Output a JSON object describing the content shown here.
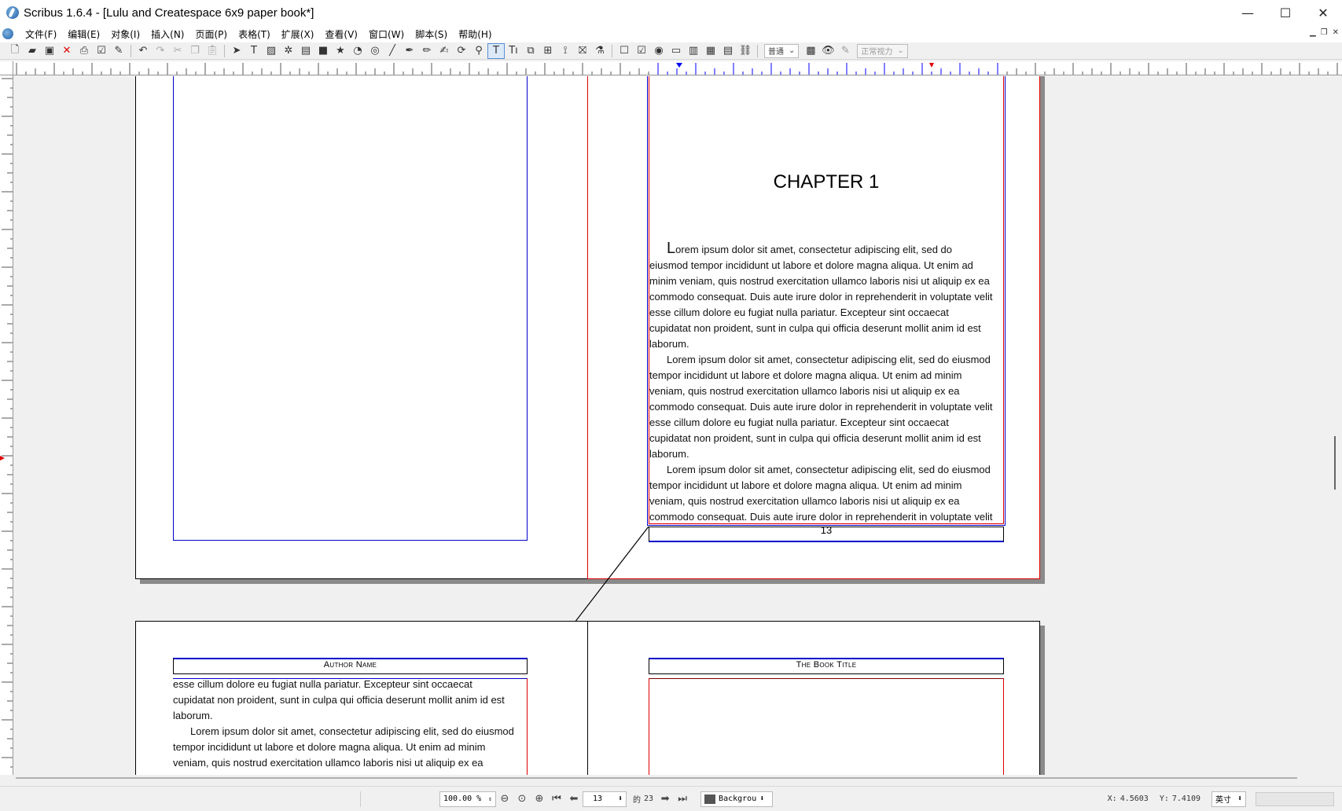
{
  "window": {
    "title": "Scribus 1.6.4 - [Lulu and Createspace 6x9 paper book*]",
    "controls": [
      "—",
      "☐",
      "✕"
    ]
  },
  "menubar": {
    "items": [
      {
        "label": "文件(F)"
      },
      {
        "label": "编辑(E)"
      },
      {
        "label": "对象(I)"
      },
      {
        "label": "插入(N)"
      },
      {
        "label": "页面(P)"
      },
      {
        "label": "表格(T)"
      },
      {
        "label": "扩展(X)"
      },
      {
        "label": "查看(V)"
      },
      {
        "label": "窗口(W)"
      },
      {
        "label": "脚本(S)"
      },
      {
        "label": "帮助(H)"
      }
    ]
  },
  "toolbar": {
    "mode_combo": "普通",
    "view_combo": "正常视力"
  },
  "document": {
    "chapter_title": "CHAPTER 1",
    "drop_cap": "L",
    "para1_rest": [
      "orem ipsum dolor sit amet, consectetur adipiscing elit, sed do",
      "eiusmod tempor incididunt ut labore et dolore magna aliqua. Ut enim ad",
      "minim veniam, quis nostrud exercitation ullamco laboris nisi ut aliquip ex ea",
      "commodo consequat. Duis aute irure dolor in reprehenderit in voluptate velit",
      "esse cillum dolore eu fugiat nulla pariatur. Excepteur sint occaecat",
      "cupidatat non proident, sunt in culpa qui officia deserunt mollit anim id est",
      "laborum."
    ],
    "para2": [
      "Lorem ipsum dolor sit amet, consectetur adipiscing elit, sed do eiusmod",
      "tempor incididunt ut labore et dolore magna aliqua. Ut enim ad minim",
      "veniam, quis nostrud exercitation ullamco laboris nisi ut aliquip ex ea",
      "commodo consequat. Duis aute irure dolor in reprehenderit in voluptate velit",
      "esse cillum dolore eu fugiat nulla pariatur. Excepteur sint occaecat",
      "cupidatat non proident, sunt in culpa qui officia deserunt mollit anim id est",
      "laborum."
    ],
    "para3": [
      "Lorem ipsum dolor sit amet, consectetur adipiscing elit, sed do eiusmod",
      "tempor incididunt ut labore et dolore magna aliqua. Ut enim ad minim",
      "veniam, quis nostrud exercitation ullamco laboris nisi ut aliquip ex ea",
      "commodo consequat. Duis aute irure dolor in reprehenderit in voluptate velit"
    ],
    "page_number": "13",
    "left_header": "Author Name",
    "right_header": "The Book Title",
    "continued_text": [
      {
        "text": "esse cillum dolore eu fugiat nulla pariatur. Excepteur sint occaecat",
        "indent": false
      },
      {
        "text": "cupidatat non proident, sunt in culpa qui officia deserunt mollit anim id est",
        "indent": false
      },
      {
        "text": "laborum.",
        "indent": false
      },
      {
        "text": "Lorem ipsum dolor sit amet, consectetur adipiscing elit, sed do eiusmod",
        "indent": true
      },
      {
        "text": "tempor incididunt ut labore et dolore magna aliqua. Ut enim ad minim",
        "indent": false
      },
      {
        "text": "veniam, quis nostrud exercitation ullamco laboris nisi ut aliquip ex ea",
        "indent": false
      }
    ]
  },
  "statusbar": {
    "zoom": "100.00 %",
    "current_page": "13",
    "of_label": "的",
    "total_pages": "23",
    "layer": "Backgrou",
    "x_label": "X:",
    "x_value": "4.5603",
    "y_label": "Y:",
    "y_value": "7.4109",
    "unit": "英寸"
  },
  "colors": {
    "frame_blue": "#0000cc",
    "selected_red": "#e00000",
    "ruler_marker": "#0000ff"
  }
}
